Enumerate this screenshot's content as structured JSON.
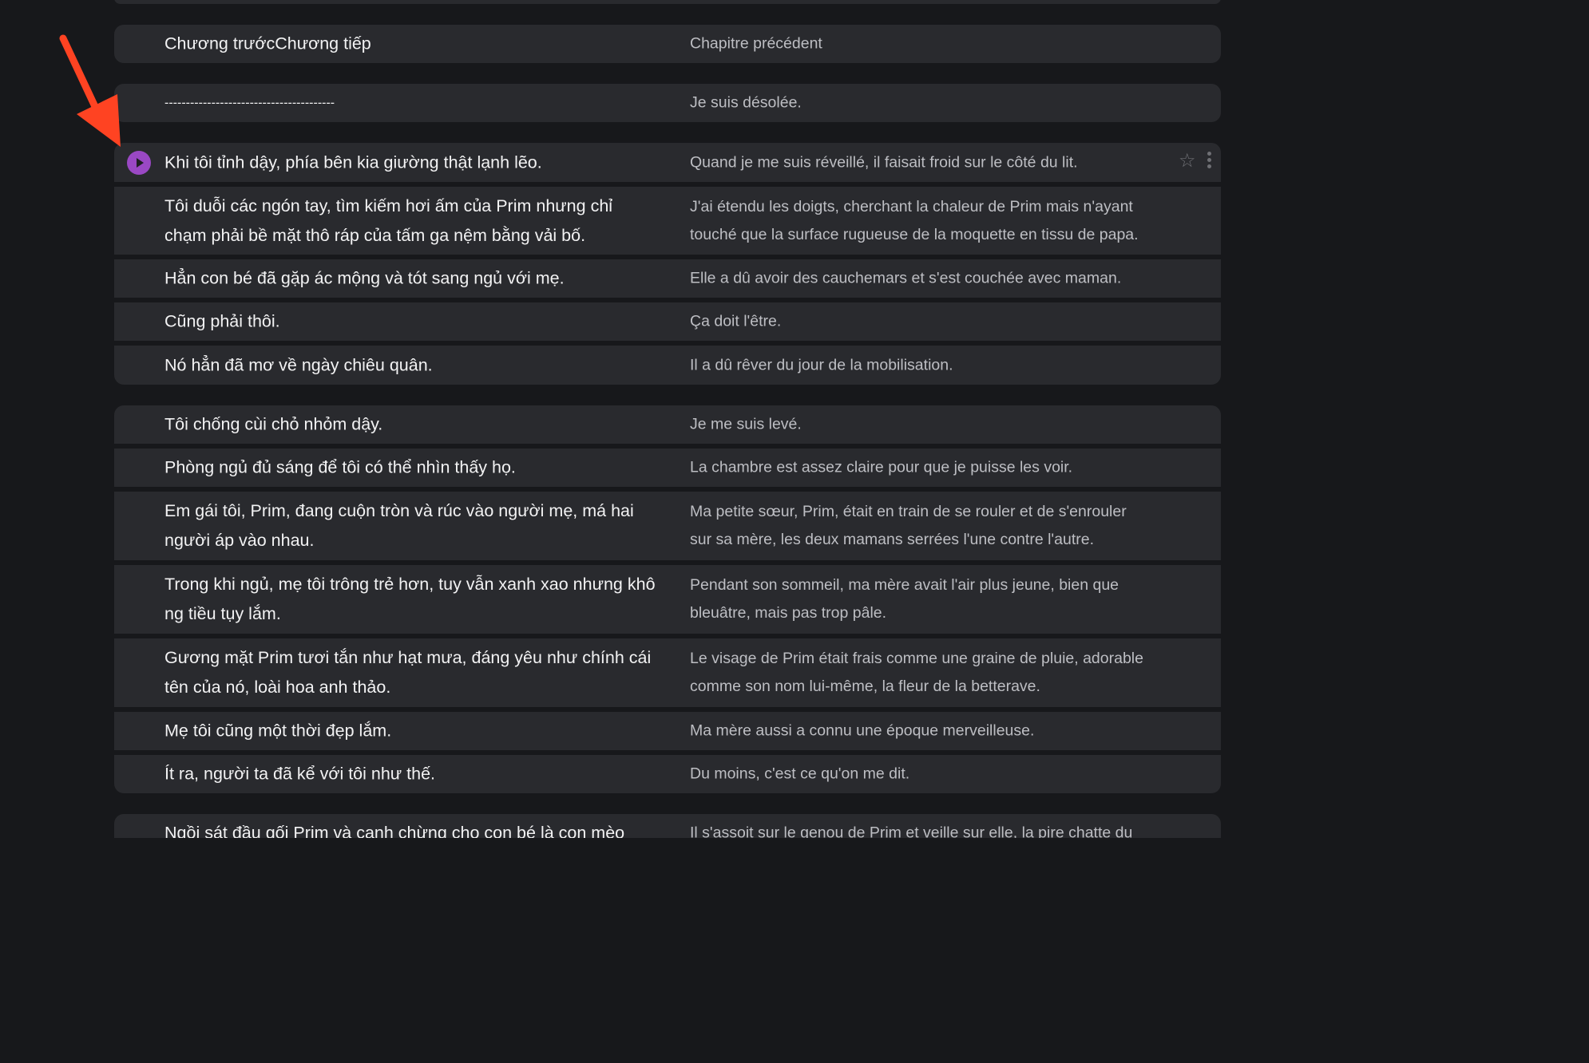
{
  "rows": {
    "nav": {
      "vi": "Chương trướcChương tiếp",
      "fr": "Chapitre précédent"
    },
    "divider": {
      "vi": "----------------------------------------",
      "fr": "Je suis désolée."
    },
    "r1": {
      "vi": "Khi tôi tỉnh dậy, phía bên kia giường thật lạnh lẽo.",
      "fr": "Quand je me suis réveillé, il faisait froid sur le côté du lit."
    },
    "r2": {
      "vi": [
        "Tôi duỗi các ngón tay, tìm kiếm hơi ấm của Prim nhưng chỉ",
        "chạm phải bề mặt thô ráp của tấm ga nệm bằng vải bố."
      ],
      "fr": [
        "J'ai étendu les doigts, cherchant la chaleur de Prim mais n'ayant",
        "touché que la surface rugueuse de la moquette en tissu de papa."
      ]
    },
    "r3": {
      "vi": "Hẳn con bé đã gặp ác mộng và tót sang ngủ với mẹ.",
      "fr": "Elle a dû avoir des cauchemars et s'est couchée avec maman."
    },
    "r4": {
      "vi": "Cũng phải thôi.",
      "fr": "Ça doit l'être."
    },
    "r5": {
      "vi": "Nó hẳn đã mơ về ngày chiêu quân.",
      "fr": "Il a dû rêver du jour de la mobilisation."
    },
    "r6": {
      "vi": "Tôi chống cùi chỏ nhỏm dậy.",
      "fr": "Je me suis levé."
    },
    "r7": {
      "vi": "Phòng ngủ đủ sáng để tôi có thể nhìn thấy họ.",
      "fr": "La chambre est assez claire pour que je puisse les voir."
    },
    "r8": {
      "vi": [
        "Em gái tôi, Prim, đang cuộn tròn và rúc vào người mẹ, má hai",
        "người áp vào nhau."
      ],
      "fr": [
        "Ma petite sœur, Prim, était en train de se rouler et de s'enrouler",
        "sur sa mère, les deux mamans serrées l'une contre l'autre."
      ]
    },
    "r9": {
      "vi": [
        "Trong khi ngủ, mẹ tôi trông trẻ hơn, tuy vẫn xanh xao nhưng khô",
        "ng tiều tụy lắm."
      ],
      "fr": [
        "Pendant son sommeil, ma mère avait l'air plus jeune, bien que",
        "bleuâtre, mais pas trop pâle."
      ]
    },
    "r10": {
      "vi": [
        "Gương mặt Prim tươi tắn như hạt mưa, đáng yêu như chính cái",
        "tên của nó, loài hoa anh thảo."
      ],
      "fr": [
        "Le visage de Prim était frais comme une graine de pluie, adorable",
        "comme son nom lui-même, la fleur de la betterave."
      ]
    },
    "r11": {
      "vi": "Mẹ tôi cũng một thời đẹp lắm.",
      "fr": "Ma mère aussi a connu une époque merveilleuse."
    },
    "r12": {
      "vi": "Ít ra, người ta đã kể với tôi như thế.",
      "fr": "Du moins, c'est ce qu'on me dit."
    },
    "r13": {
      "vi": "Ngồi sát đầu gối Prim và canh chừng cho con bé là con mèo",
      "fr": "Il s'assoit sur le genou de Prim et veille sur elle, la pire chatte du"
    }
  },
  "colors": {
    "accent": "#9a48c4",
    "arrow": "#ff4322",
    "row_bg": "#292a2e",
    "page_bg": "#17181b"
  },
  "icons": {
    "play": "play-icon",
    "star": "star-icon",
    "more": "more-vertical-icon"
  }
}
